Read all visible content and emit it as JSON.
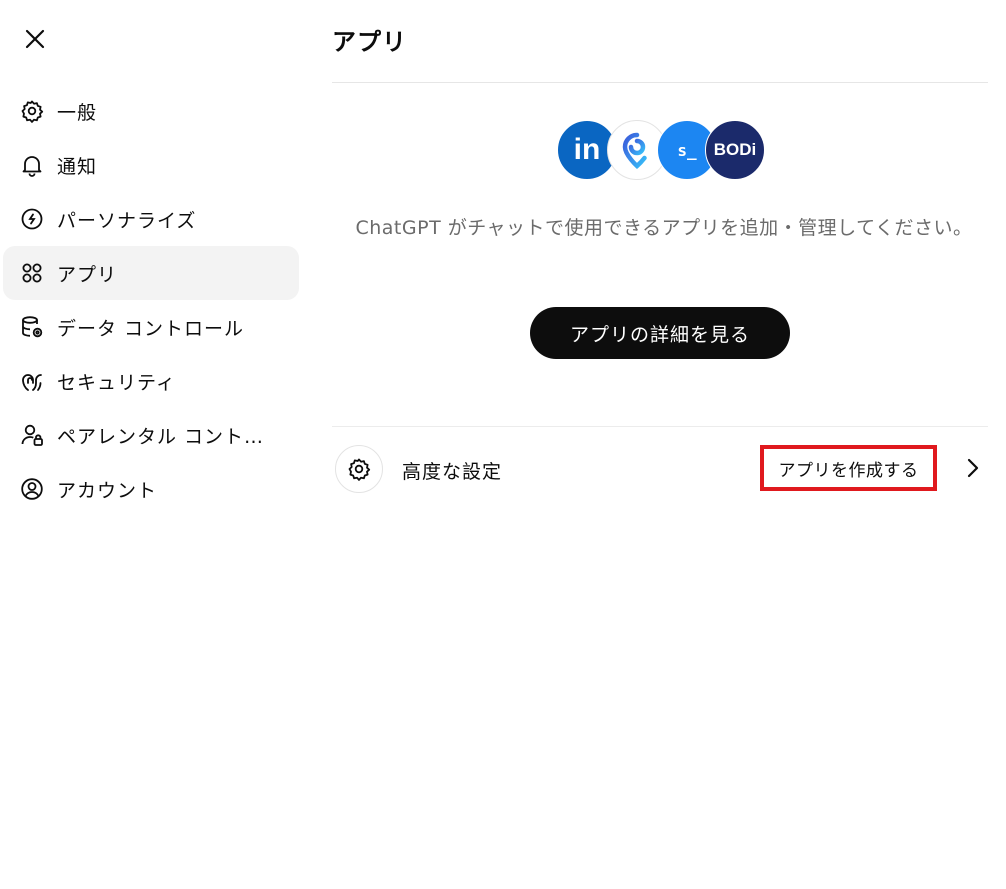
{
  "sidebar": {
    "items": [
      {
        "label": "一般",
        "icon": "gear-icon"
      },
      {
        "label": "通知",
        "icon": "bell-icon"
      },
      {
        "label": "パーソナライズ",
        "icon": "personalize-icon"
      },
      {
        "label": "アプリ",
        "icon": "apps-grid-icon"
      },
      {
        "label": "データ コントロール",
        "icon": "database-gear-icon"
      },
      {
        "label": "セキュリティ",
        "icon": "security-icon"
      },
      {
        "label": "ペアレンタル コント…",
        "icon": "user-lock-icon"
      },
      {
        "label": "アカウント",
        "icon": "account-icon"
      }
    ],
    "active_index": 3
  },
  "main": {
    "title": "アプリ",
    "logos": {
      "linkedin": "in",
      "terminal": "s_",
      "bodi": "BODi"
    },
    "description": "ChatGPT がチャットで使用できるアプリを追加・管理してください。",
    "primary_button": "アプリの詳細を見る",
    "advanced": {
      "label": "高度な設定",
      "create_button": "アプリを作成する"
    }
  },
  "colors": {
    "highlight_border": "#e0191e",
    "primary_button_bg": "#0d0d0d",
    "active_nav_bg": "#f3f3f3",
    "linkedin_blue": "#0a66c2",
    "terminal_blue": "#1c86f2",
    "bodi_navy": "#1b2a6b"
  }
}
